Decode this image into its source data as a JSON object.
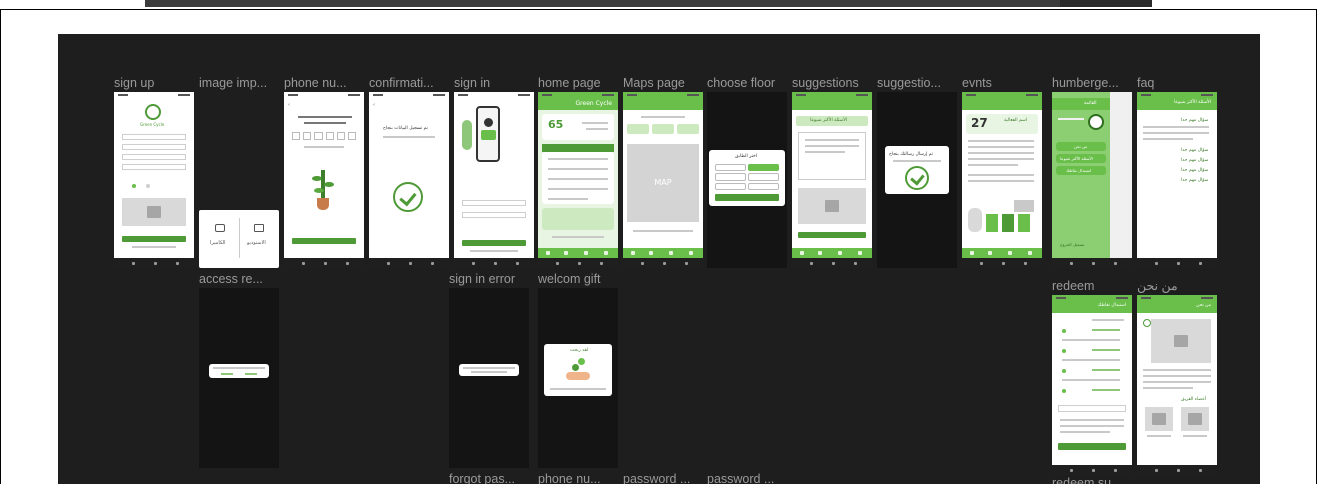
{
  "frames": {
    "sign_up": "sign up",
    "image_imp": "image imp...",
    "phone_nu": "phone nu...",
    "confirmati": "confirmati...",
    "sign_in": "sign in",
    "home_page": "home page",
    "maps_page": "Maps page",
    "choose_floor": "choose floor",
    "suggestions": "suggestions",
    "suggestio": "suggestio...",
    "evnts": "evnts",
    "humberge": "humberge...",
    "faq": "faq",
    "access_re": "access re...",
    "sign_in_error": "sign in error",
    "welcom_gift": "welcom gift",
    "redeem": "redeem",
    "about_us": "من نحن",
    "forgot_pas": "forgot pas...",
    "phone_nu_2": "phone nu...",
    "password_1": "password ...",
    "password_2": "password ...",
    "redeem_su": "redeem su..."
  },
  "screens": {
    "app_name": "Green Cycle",
    "home_points": "65",
    "events_day": "27",
    "map_label": "MAP",
    "image_import_options": [
      "الكاميرا",
      "الاستوديو"
    ],
    "humberger_menu_title": "القائمة",
    "humberger_items": [
      "من نحن",
      "الأسئلة الأكثر شيوعا",
      "استبدال نقاطك"
    ],
    "humberger_logout": "تسجيل الخروج",
    "faq_title": "الأسئلة الأكثر شيوعا",
    "faq_items": [
      "سؤال مهم جدا",
      "سؤال مهم جدا",
      "سؤال مهم جدا",
      "سؤال مهم جدا",
      "سؤال مهم جدا"
    ],
    "redeem_title": "استبدال نقاطك",
    "about_title": "من نحن",
    "about_team": "أعضاء الفريق",
    "suggestions_faq": "الأسئلة الأكثر شيوعا",
    "welcome_gift_title": "لقد ربحت",
    "events_title": "اسم الفعالية",
    "confirm_text": "تم تسجيل البيانات بنجاح",
    "suggestion_sent": "تم إرسال رسالتك بنجاح",
    "choose_floor_title": "اختر الطابق"
  },
  "colors": {
    "canvas": "#1e1e1e",
    "brand_green": "#6abf4b",
    "dark_green": "#4e9a36",
    "frame_label": "#9a9a9a"
  }
}
